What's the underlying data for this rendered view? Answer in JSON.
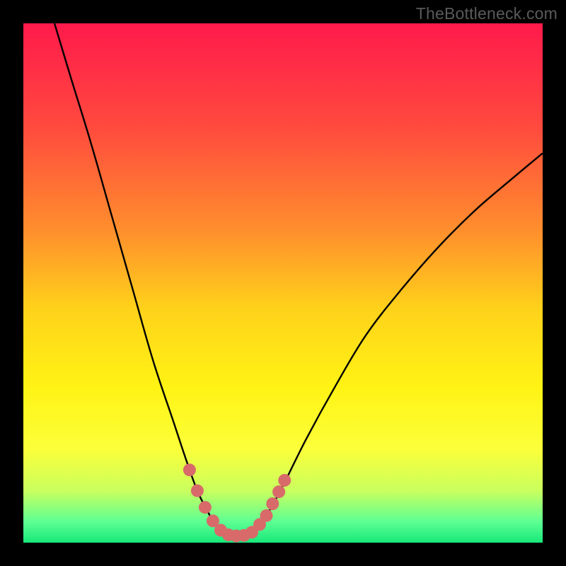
{
  "watermark": "TheBottleneck.com",
  "chart_data": {
    "type": "line",
    "title": "",
    "xlabel": "",
    "ylabel": "",
    "xlim": [
      0,
      1
    ],
    "ylim": [
      0,
      1
    ],
    "gradient_stops": [
      {
        "offset": 0.0,
        "color": "#ff1a4b"
      },
      {
        "offset": 0.2,
        "color": "#ff4a3e"
      },
      {
        "offset": 0.4,
        "color": "#ff8f2d"
      },
      {
        "offset": 0.55,
        "color": "#ffd21a"
      },
      {
        "offset": 0.7,
        "color": "#fff314"
      },
      {
        "offset": 0.82,
        "color": "#fbff3a"
      },
      {
        "offset": 0.9,
        "color": "#c9ff5e"
      },
      {
        "offset": 0.96,
        "color": "#5dff93"
      },
      {
        "offset": 1.0,
        "color": "#17e87a"
      }
    ],
    "series": [
      {
        "name": "bottleneck-curve",
        "color": "#000000",
        "points": [
          {
            "x": 0.06,
            "y": 1.0
          },
          {
            "x": 0.09,
            "y": 0.9
          },
          {
            "x": 0.13,
            "y": 0.77
          },
          {
            "x": 0.17,
            "y": 0.63
          },
          {
            "x": 0.21,
            "y": 0.49
          },
          {
            "x": 0.25,
            "y": 0.35
          },
          {
            "x": 0.29,
            "y": 0.23
          },
          {
            "x": 0.315,
            "y": 0.155
          },
          {
            "x": 0.335,
            "y": 0.1
          },
          {
            "x": 0.355,
            "y": 0.06
          },
          {
            "x": 0.37,
            "y": 0.035
          },
          {
            "x": 0.39,
            "y": 0.018
          },
          {
            "x": 0.41,
            "y": 0.013
          },
          {
            "x": 0.43,
            "y": 0.015
          },
          {
            "x": 0.45,
            "y": 0.028
          },
          {
            "x": 0.47,
            "y": 0.055
          },
          {
            "x": 0.5,
            "y": 0.11
          },
          {
            "x": 0.545,
            "y": 0.2
          },
          {
            "x": 0.6,
            "y": 0.3
          },
          {
            "x": 0.66,
            "y": 0.4
          },
          {
            "x": 0.73,
            "y": 0.49
          },
          {
            "x": 0.8,
            "y": 0.57
          },
          {
            "x": 0.87,
            "y": 0.64
          },
          {
            "x": 0.94,
            "y": 0.7
          },
          {
            "x": 1.0,
            "y": 0.75
          }
        ]
      },
      {
        "name": "highlight-dots-left",
        "color": "#d86a6a",
        "points": [
          {
            "x": 0.32,
            "y": 0.14
          },
          {
            "x": 0.335,
            "y": 0.1
          },
          {
            "x": 0.35,
            "y": 0.068
          },
          {
            "x": 0.365,
            "y": 0.042
          },
          {
            "x": 0.38,
            "y": 0.024
          },
          {
            "x": 0.395,
            "y": 0.015
          },
          {
            "x": 0.41,
            "y": 0.013
          },
          {
            "x": 0.425,
            "y": 0.014
          },
          {
            "x": 0.44,
            "y": 0.02
          }
        ]
      },
      {
        "name": "highlight-dots-right",
        "color": "#d86a6a",
        "points": [
          {
            "x": 0.455,
            "y": 0.035
          },
          {
            "x": 0.468,
            "y": 0.052
          },
          {
            "x": 0.48,
            "y": 0.075
          },
          {
            "x": 0.492,
            "y": 0.098
          },
          {
            "x": 0.503,
            "y": 0.12
          }
        ]
      }
    ]
  }
}
